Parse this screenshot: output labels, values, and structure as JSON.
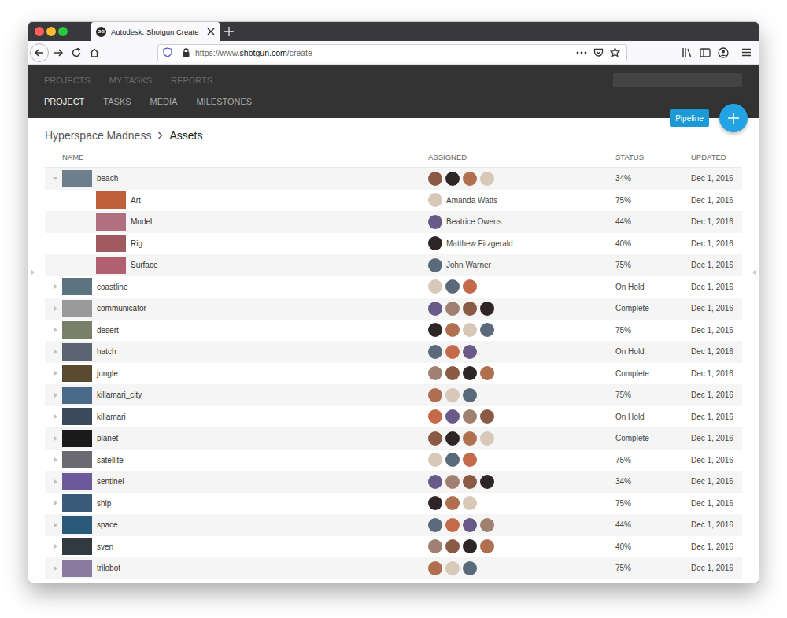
{
  "window": {
    "tab": {
      "favicon": "SG",
      "title": "Autodesk: Shotgun Create"
    },
    "url": {
      "prefix": "https://www.",
      "host": "shotgun.com",
      "path": "/create"
    }
  },
  "nav": {
    "top": [
      {
        "label": "PROJECTS",
        "selected": false
      },
      {
        "label": "MY TASKS",
        "selected": false
      },
      {
        "label": "REPORTS",
        "selected": false
      }
    ],
    "sub": [
      {
        "label": "PROJECT",
        "selected": true
      },
      {
        "label": "TASKS",
        "selected": false
      },
      {
        "label": "MEDIA",
        "selected": false
      },
      {
        "label": "MILESTONES",
        "selected": false
      }
    ]
  },
  "pipeline_button": "Pipeline",
  "breadcrumb": [
    "Hyperspace Madness",
    "Assets"
  ],
  "table": {
    "columns": [
      "NAME",
      "ASSIGNED",
      "STATUS",
      "UPDATED"
    ],
    "rows": [
      {
        "name": "beach",
        "expanded": true,
        "avatars": 4,
        "status": "34%",
        "updated": "Dec 1, 2016",
        "children": [
          {
            "name": "Art",
            "assignee": "Amanda Watts",
            "status": "75%",
            "updated": "Dec 1, 2016"
          },
          {
            "name": "Model",
            "assignee": "Beatrice Owens",
            "status": "44%",
            "updated": "Dec 1, 2016"
          },
          {
            "name": "Rig",
            "assignee": "Matthew Fitzgerald",
            "status": "40%",
            "updated": "Dec 1, 2016"
          },
          {
            "name": "Surface",
            "assignee": "John Warner",
            "status": "75%",
            "updated": "Dec 1, 2016"
          }
        ]
      },
      {
        "name": "coastline",
        "expanded": false,
        "avatars": 3,
        "status": "On Hold",
        "updated": "Dec 1, 2016",
        "children": []
      },
      {
        "name": "communicator",
        "expanded": false,
        "avatars": 4,
        "status": "Complete",
        "updated": "Dec 1, 2016",
        "children": []
      },
      {
        "name": "desert",
        "expanded": false,
        "avatars": 4,
        "status": "75%",
        "updated": "Dec 1, 2016",
        "children": []
      },
      {
        "name": "hatch",
        "expanded": false,
        "avatars": 3,
        "status": "On Hold",
        "updated": "Dec 1, 2016",
        "children": []
      },
      {
        "name": "jungle",
        "expanded": false,
        "avatars": 4,
        "status": "Complete",
        "updated": "Dec 1, 2016",
        "children": []
      },
      {
        "name": "killamari_city",
        "expanded": false,
        "avatars": 3,
        "status": "75%",
        "updated": "Dec 1, 2016",
        "children": []
      },
      {
        "name": "killamari",
        "expanded": false,
        "avatars": 4,
        "status": "On Hold",
        "updated": "Dec 1, 2016",
        "children": []
      },
      {
        "name": "planet",
        "expanded": false,
        "avatars": 4,
        "status": "Complete",
        "updated": "Dec 1, 2016",
        "children": []
      },
      {
        "name": "satellite",
        "expanded": false,
        "avatars": 3,
        "status": "75%",
        "updated": "Dec 1, 2016",
        "children": []
      },
      {
        "name": "sentinel",
        "expanded": false,
        "avatars": 4,
        "status": "34%",
        "updated": "Dec 1, 2016",
        "children": []
      },
      {
        "name": "ship",
        "expanded": false,
        "avatars": 3,
        "status": "75%",
        "updated": "Dec 1, 2016",
        "children": []
      },
      {
        "name": "space",
        "expanded": false,
        "avatars": 4,
        "status": "44%",
        "updated": "Dec 1, 2016",
        "children": []
      },
      {
        "name": "sven",
        "expanded": false,
        "avatars": 4,
        "status": "40%",
        "updated": "Dec 1, 2016",
        "children": []
      },
      {
        "name": "trilobot",
        "expanded": false,
        "avatars": 3,
        "status": "75%",
        "updated": "Dec 1, 2016",
        "children": []
      }
    ]
  }
}
